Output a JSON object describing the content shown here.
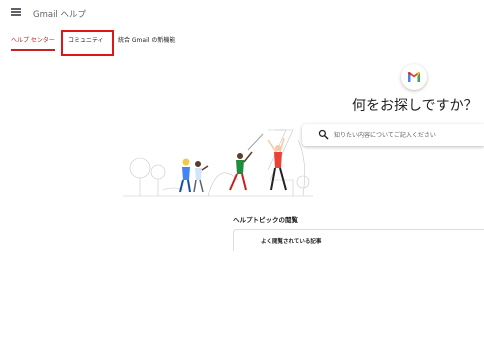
{
  "header": {
    "title": "Gmail ヘルプ",
    "menu_icon": "menu-icon"
  },
  "tabs": [
    {
      "label": "ヘルプ センター",
      "active": true
    },
    {
      "label": "コミュニティ",
      "active": false
    },
    {
      "label": "統合 Gmail の新機能",
      "active": false
    }
  ],
  "hero": {
    "logo_icon": "gmail-logo-icon",
    "title": "何をお探しですか？"
  },
  "search": {
    "placeholder": "知りたい内容についてご記入ください",
    "icon": "search-icon"
  },
  "help_topics": {
    "title": "ヘルプトピックの閲覧",
    "items": [
      "よく閲覧されている記事"
    ]
  },
  "colors": {
    "accent": "#c5221f",
    "highlight_box": "#e01515",
    "text": "#202124",
    "muted": "#5f6368"
  }
}
